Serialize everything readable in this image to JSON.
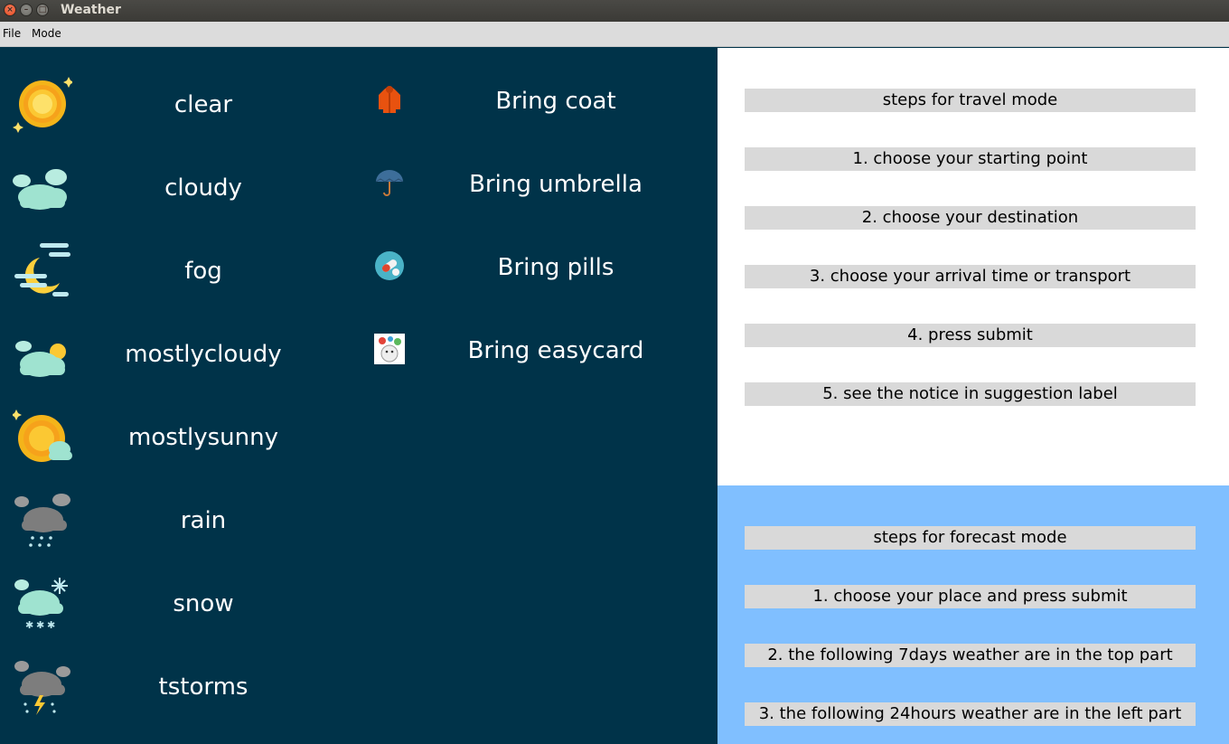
{
  "window": {
    "title": "Weather"
  },
  "menu": {
    "file": "File",
    "mode": "Mode"
  },
  "weather_types": [
    {
      "label": "clear",
      "icon": "sun-icon"
    },
    {
      "label": "cloudy",
      "icon": "clouds-icon"
    },
    {
      "label": "fog",
      "icon": "fog-moon-icon"
    },
    {
      "label": "mostlycloudy",
      "icon": "mostly-cloudy-icon"
    },
    {
      "label": "mostlysunny",
      "icon": "mostly-sunny-icon"
    },
    {
      "label": "rain",
      "icon": "rain-icon"
    },
    {
      "label": "snow",
      "icon": "snow-icon"
    },
    {
      "label": "tstorms",
      "icon": "thunderstorm-icon"
    }
  ],
  "suggestions": [
    {
      "label": "Bring coat",
      "icon": "coat-icon"
    },
    {
      "label": "Bring umbrella",
      "icon": "umbrella-icon"
    },
    {
      "label": "Bring pills",
      "icon": "pills-icon"
    },
    {
      "label": "Bring easycard",
      "icon": "easycard-icon"
    }
  ],
  "travel_steps": {
    "heading": "steps for travel mode",
    "items": [
      "1. choose your starting point",
      "2. choose your destination",
      "3. choose your arrival time or transport",
      "4. press submit",
      "5. see the notice in suggestion label"
    ]
  },
  "forecast_steps": {
    "heading": "steps for forecast mode",
    "items": [
      "1. choose your place and press submit",
      "2. the following 7days weather are in the top part",
      "3. the following 24hours weather are in the left  part"
    ]
  },
  "colors": {
    "left_bg": "#003349",
    "travel_bg": "#ffffff",
    "forecast_bg": "#80bfff",
    "step_bg": "#d9d9d9"
  }
}
